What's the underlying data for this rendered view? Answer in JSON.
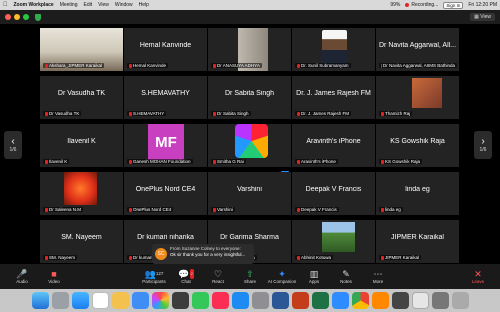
{
  "menubar": {
    "app": "Zoom Workplace",
    "menus": [
      "Meeting",
      "Edit",
      "View",
      "Window",
      "Help"
    ],
    "battery": "99%",
    "recording": "Recording...",
    "sign_in": "Sign In",
    "clock": "Fri 12:20 PM"
  },
  "titlebar": {
    "view": "View"
  },
  "gallery": {
    "page_left": "1/6",
    "page_right": "1/6",
    "tiles": [
      {
        "center": "",
        "label": "Akshara_JIPMER Karaikal",
        "video": "room"
      },
      {
        "center": "Hemal Kanvinde",
        "label": "Hemal Kanvinde"
      },
      {
        "center": "",
        "label": "Dr ANASUYA ADHYA",
        "video": "door"
      },
      {
        "center": "",
        "label": "Dr. Sunil Subramanyam",
        "video": "person"
      },
      {
        "center": "Dr Navita Aggarwal, All...",
        "label": "Dr Navita Aggarwal, AIIMS Bathinda"
      },
      {
        "center": "Dr Vasudha TK",
        "label": "Dr Vasudha TK"
      },
      {
        "center": "S.HEMAVATHY",
        "label": "S.HEMAVATHY"
      },
      {
        "center": "Dr Sabita Singh",
        "label": "Dr Sabita Singh"
      },
      {
        "center": "Dr. J. James Rajesh FM",
        "label": "Dr. J. James Rajesh FM"
      },
      {
        "center": "",
        "label": "Thamizh Raj",
        "video": "photo"
      },
      {
        "center": "Ilavenil K",
        "label": "Ilavenil K"
      },
      {
        "center": "",
        "label": "Ganesh MOHAN Foundation",
        "video": "mf",
        "initials": "MF"
      },
      {
        "center": "",
        "label": "Smitha G Rai",
        "video": "lion"
      },
      {
        "center": "Aravinth's iPhone",
        "label": "Aravinth's iPhone"
      },
      {
        "center": "KS Gowshik Raja",
        "label": "KS Gowshik Raja"
      },
      {
        "center": "",
        "label": "Dr Saleena N.M",
        "video": "flower"
      },
      {
        "center": "OnePlus Nord CE4",
        "label": "OnePlus Nord CE4"
      },
      {
        "center": "Varshini",
        "label": "Varshini"
      },
      {
        "center": "Deepak V Francis",
        "label": "Deepak V Francis"
      },
      {
        "center": "linda eg",
        "label": "linda eg"
      },
      {
        "center": "SM. Nayeem",
        "label": "SM. Nayeem"
      },
      {
        "center": "Dr kumari niharika",
        "label": "Dr kumari niharika"
      },
      {
        "center": "Dr Garima Sharma",
        "label": "Dr Garima Sharma"
      },
      {
        "center": "",
        "label": "Abhinit Kotuwa",
        "video": "field"
      },
      {
        "center": "JIPMER Karaikal",
        "label": "JIPMER Karaikal"
      }
    ]
  },
  "toast": {
    "avatar": "SC",
    "from": "From Suzanne Colney to everyone:",
    "message": "Ok sir thank you for a very insightful..."
  },
  "toolbar": {
    "audio": "Audio",
    "video": "Video",
    "participants": "Participants",
    "participants_count": "127",
    "chat": "Chat",
    "chat_badge": "2",
    "react": "React",
    "share": "Share",
    "ai": "AI Companion",
    "apps": "Apps",
    "notes": "Notes",
    "more": "More",
    "leave": "Leave"
  },
  "colors": {
    "accent": "#2d8cff",
    "leave": "#ff5a5a",
    "mf_tile": "#c83fbf"
  }
}
